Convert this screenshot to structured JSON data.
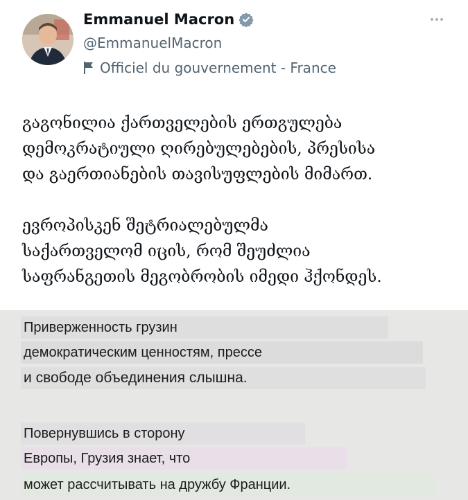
{
  "author": {
    "display_name": "Emmanuel Macron",
    "handle": "@EmmanuelMacron",
    "label": "Officiel du gouvernement - France",
    "verified": true,
    "avatar_icon": "person-portrait-icon",
    "badge_color": "#829aab"
  },
  "tweet": {
    "paragraphs": [
      "გაგონილია ქართველების ერთგულება\nდემოკრატიული ღირებულებების, პრესისა\nდა გაერთიანების თავისუფლების მიმართ.",
      "ევროპისკენ შეტრიალებულმა\nსაქართველომ იცის, რომ შეუძლია\nსაფრანგეთის მეგობრობის იმედი ჰქონდეს."
    ]
  },
  "translation": {
    "lines": [
      {
        "text": "Приверженность грузин",
        "highlight": "#dedede"
      },
      {
        "text": "демократическим ценностям, прессе",
        "highlight": "#dcdcdc"
      },
      {
        "text": "и свободе объединения слышна.",
        "highlight": "#dfdfdf"
      },
      {
        "text": "Повернувшись в сторону",
        "highlight": "#e1dfe2"
      },
      {
        "text": "Европы, Грузия знает, что",
        "highlight": "#e8dfe9"
      },
      {
        "text": "может рассчитывать на дружбу Франции.",
        "highlight": "#e2e9e1"
      }
    ]
  }
}
